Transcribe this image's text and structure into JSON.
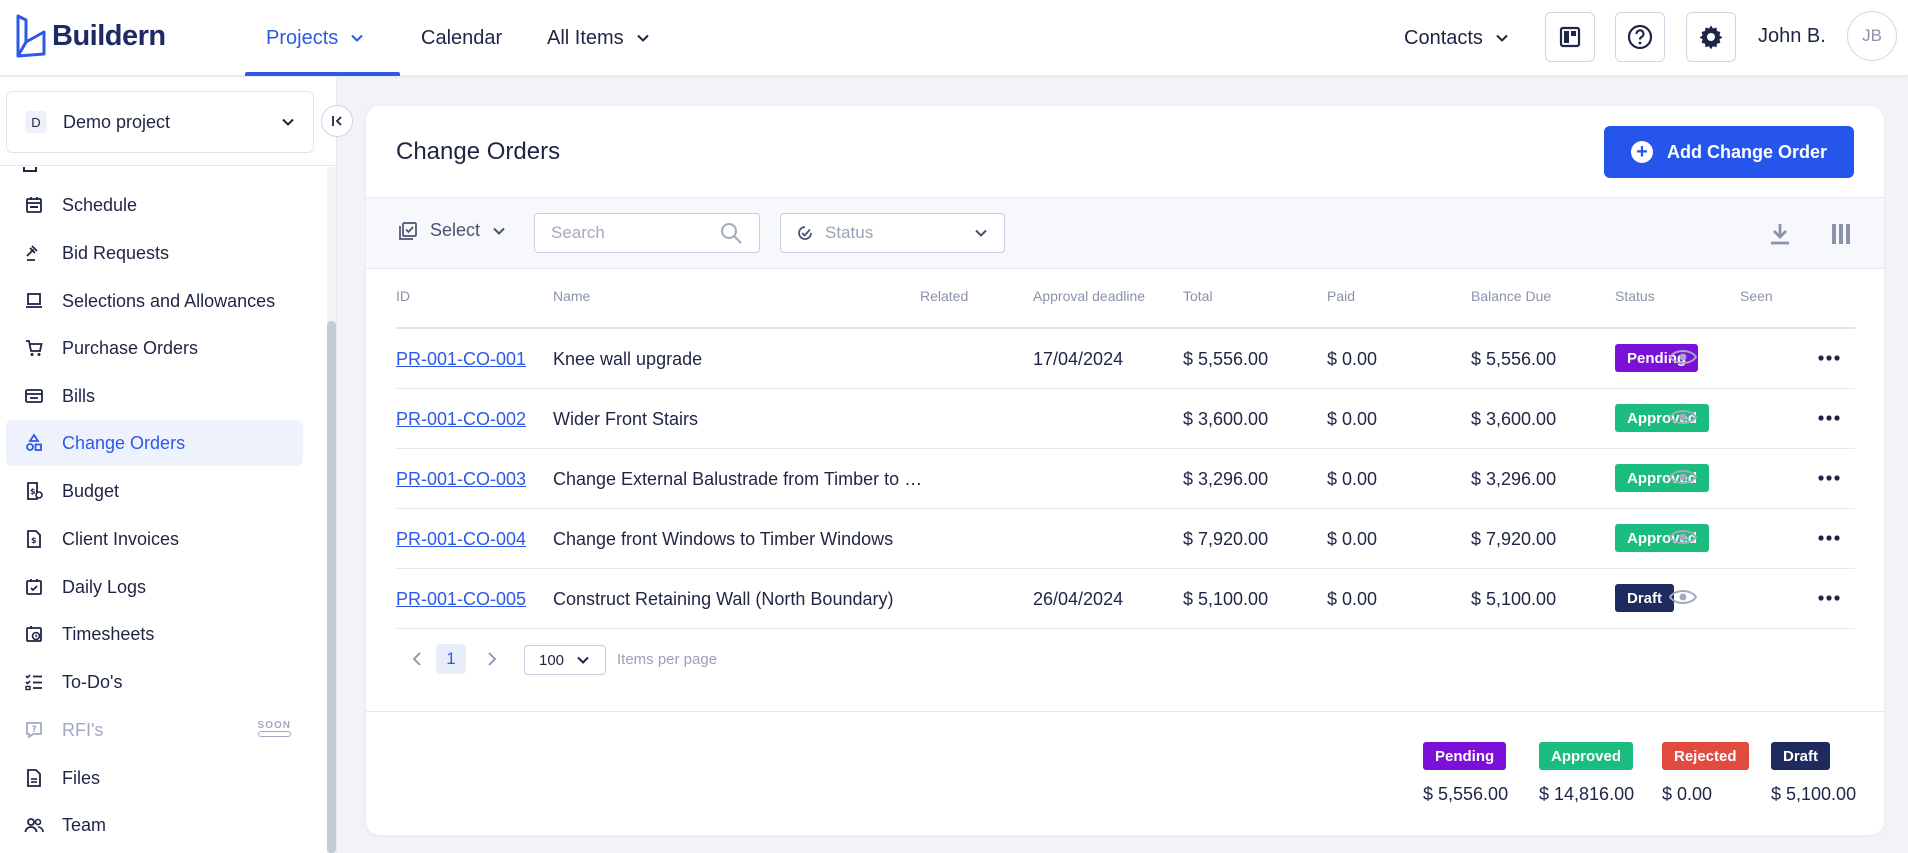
{
  "app": {
    "name": "Buildern"
  },
  "topnav": {
    "items": [
      {
        "label": "Projects",
        "active": true
      },
      {
        "label": "Calendar"
      },
      {
        "label": "All Items"
      }
    ],
    "contacts_label": "Contacts",
    "user_name": "John B.",
    "user_initials": "JB"
  },
  "sidebar": {
    "project_badge": "D",
    "project_name": "Demo project",
    "items": [
      {
        "label": "Schedule",
        "icon": "calendar-icon"
      },
      {
        "label": "Bid Requests",
        "icon": "gavel-icon"
      },
      {
        "label": "Selections and Allowances",
        "icon": "monitor-icon"
      },
      {
        "label": "Purchase Orders",
        "icon": "cart-icon"
      },
      {
        "label": "Bills",
        "icon": "wallet-icon"
      },
      {
        "label": "Change Orders",
        "icon": "shapes-icon",
        "active": true
      },
      {
        "label": "Budget",
        "icon": "budget-icon"
      },
      {
        "label": "Client Invoices",
        "icon": "invoice-icon"
      },
      {
        "label": "Daily Logs",
        "icon": "daily-log-icon"
      },
      {
        "label": "Timesheets",
        "icon": "timesheet-icon"
      },
      {
        "label": "To-Do's",
        "icon": "checklist-icon"
      },
      {
        "label": "RFI's",
        "icon": "question-chat-icon",
        "disabled": true,
        "tag": "SOON"
      },
      {
        "label": "Files",
        "icon": "file-icon"
      },
      {
        "label": "Team",
        "icon": "team-icon"
      }
    ]
  },
  "page": {
    "title": "Change Orders",
    "add_button": "Add Change Order"
  },
  "toolbar": {
    "select_label": "Select",
    "search_placeholder": "Search",
    "status_placeholder": "Status"
  },
  "table": {
    "columns": [
      "ID",
      "Name",
      "Related",
      "Approval deadline",
      "Total",
      "Paid",
      "Balance Due",
      "Status",
      "Seen"
    ],
    "rows": [
      {
        "id": "PR-001-CO-001",
        "name": "Knee wall upgrade",
        "related": "",
        "deadline": "17/04/2024",
        "total": "$ 5,556.00",
        "paid": "$ 0.00",
        "balance": "$ 5,556.00",
        "status": "Pending"
      },
      {
        "id": "PR-001-CO-002",
        "name": "Wider Front Stairs",
        "related": "",
        "deadline": "",
        "total": "$ 3,600.00",
        "paid": "$ 0.00",
        "balance": "$ 3,600.00",
        "status": "Approved"
      },
      {
        "id": "PR-001-CO-003",
        "name": "Change External Balustrade from Timber to …",
        "related": "",
        "deadline": "",
        "total": "$ 3,296.00",
        "paid": "$ 0.00",
        "balance": "$ 3,296.00",
        "status": "Approved"
      },
      {
        "id": "PR-001-CO-004",
        "name": "Change front Windows to Timber Windows",
        "related": "",
        "deadline": "",
        "total": "$ 7,920.00",
        "paid": "$ 0.00",
        "balance": "$ 7,920.00",
        "status": "Approved"
      },
      {
        "id": "PR-001-CO-005",
        "name": "Construct Retaining Wall (North Boundary)",
        "related": "",
        "deadline": "26/04/2024",
        "total": "$ 5,100.00",
        "paid": "$ 0.00",
        "balance": "$ 5,100.00",
        "status": "Draft"
      }
    ]
  },
  "pagination": {
    "current_page": "1",
    "per_page": "100",
    "per_page_label": "Items per page"
  },
  "summary": [
    {
      "label": "Pending",
      "value": "$ 5,556.00",
      "color": "#7b10d8"
    },
    {
      "label": "Approved",
      "value": "$ 14,816.00",
      "color": "#1bbd7e"
    },
    {
      "label": "Rejected",
      "value": "$ 0.00",
      "color": "#e04a3f"
    },
    {
      "label": "Draft",
      "value": "$ 5,100.00",
      "color": "#1f2a5e"
    }
  ],
  "colors": {
    "accent": "#2d59e8",
    "button": "#2555eb",
    "pending": "#7b10d8",
    "approved": "#1bbd7e",
    "rejected": "#e04a3f",
    "draft": "#1f2a5e"
  }
}
